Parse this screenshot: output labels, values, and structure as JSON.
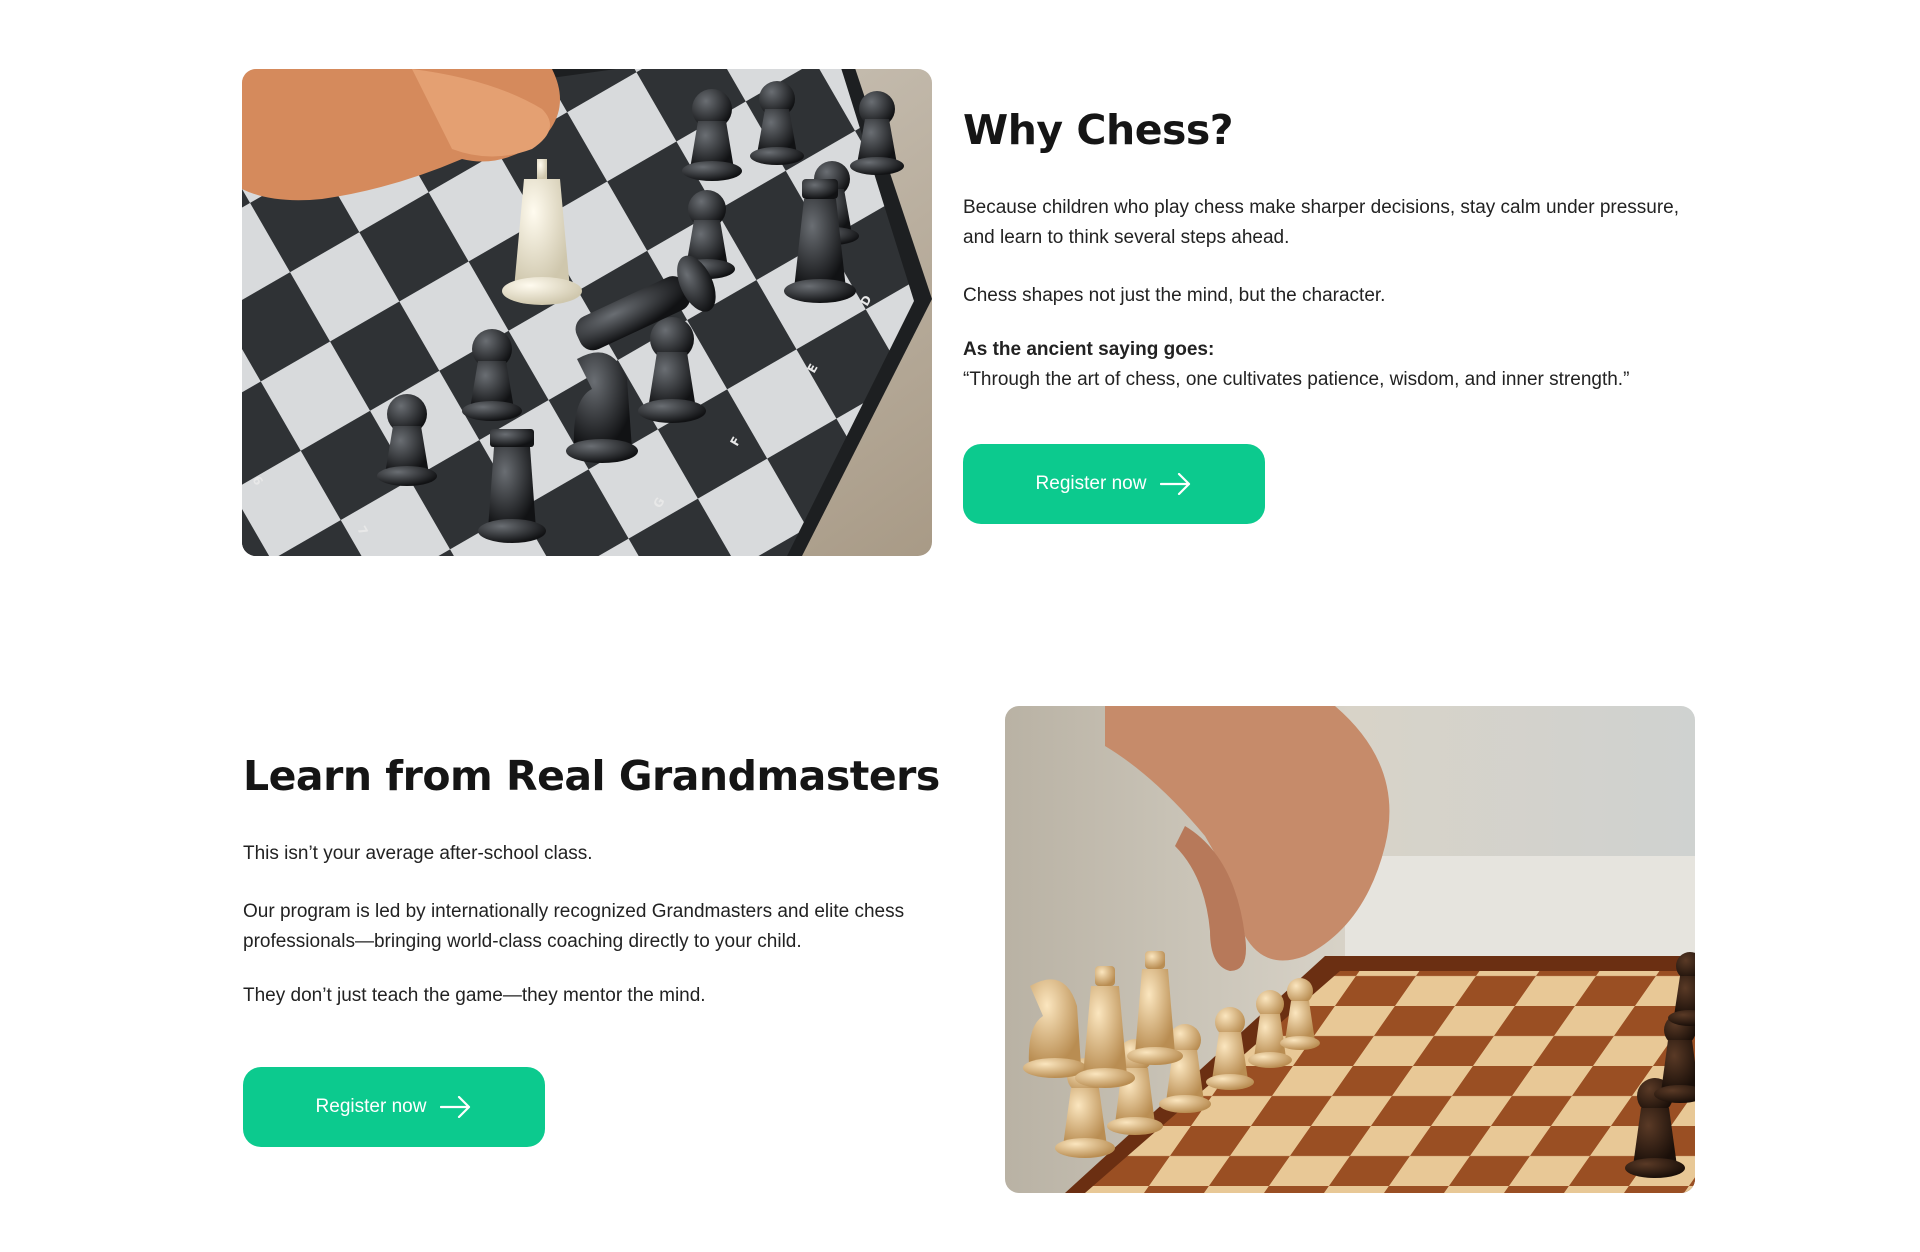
{
  "section1": {
    "title": "Why Chess?",
    "p1": "Because children who play chess make sharper decisions, stay calm under pressure, and learn to think several steps ahead.",
    "p2": "Chess shapes not just the mind, but the character.",
    "saying_label": "As the ancient saying goes:",
    "saying_quote": "“Through the art of chess, one cultivates patience, wisdom, and inner strength.”",
    "button_label": "Register now",
    "image_icon": "black-white-chess-board-photo"
  },
  "section2": {
    "title": "Learn from Real Grandmasters",
    "p1": "This isn’t your average after-school class.",
    "p2": "Our program is led by internationally recognized Grandmasters and elite chess professionals—bringing world-class coaching directly to your child.",
    "p3": "They don’t just teach the game—they mentor the mind.",
    "button_label": "Register now",
    "image_icon": "wooden-chess-board-hand-photo"
  },
  "colors": {
    "accent": "#0cca8e",
    "heading": "#151515",
    "text": "#222222",
    "background": "#ffffff"
  }
}
